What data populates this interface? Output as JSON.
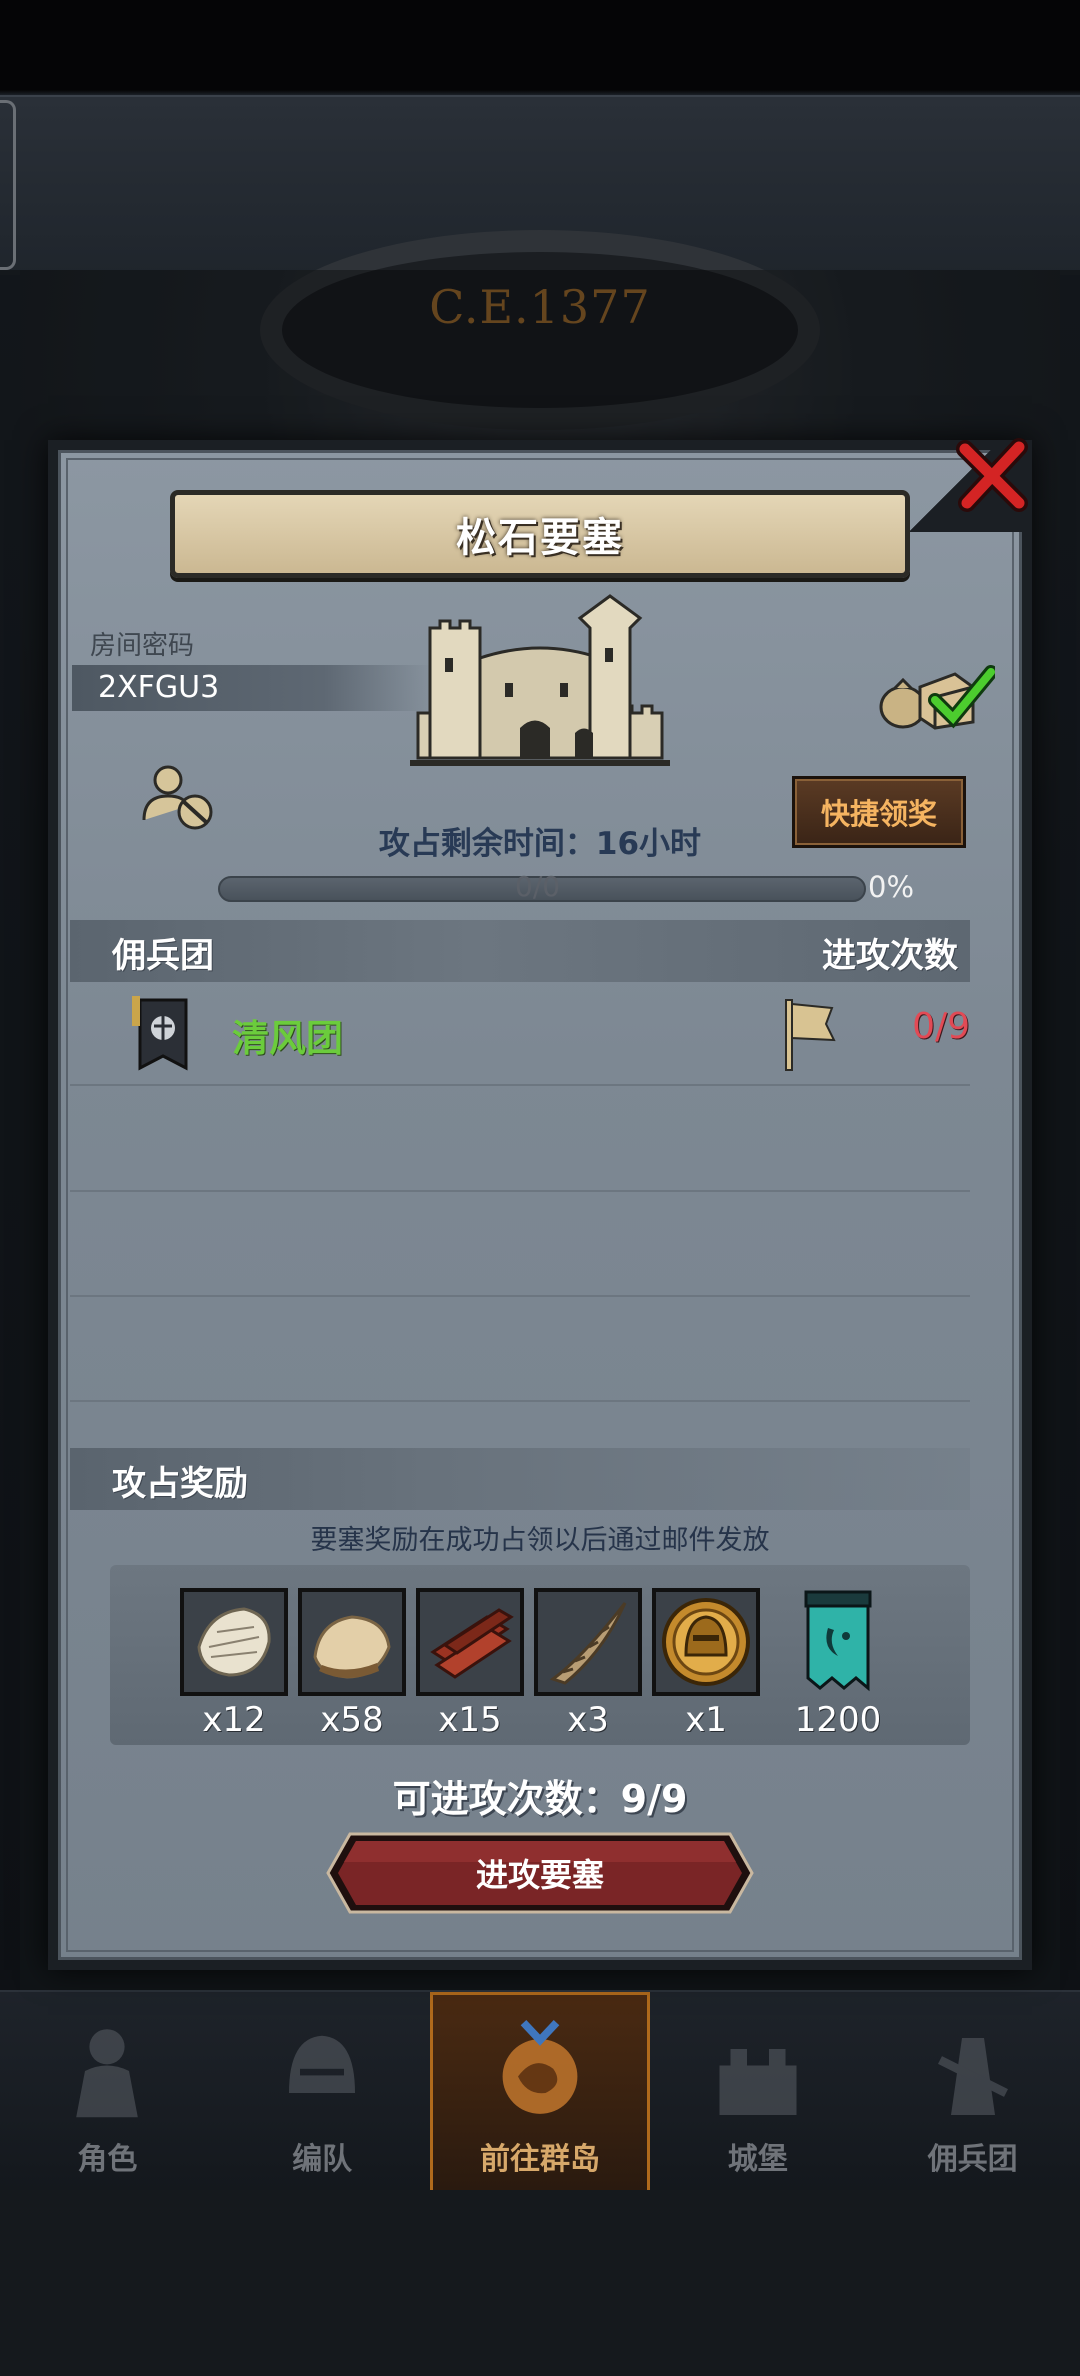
{
  "background": {
    "year": "C.E.1377"
  },
  "bottom_nav": {
    "items": [
      {
        "label": "角色",
        "icon": "knight-icon"
      },
      {
        "label": "编队",
        "icon": "helmet-icon"
      },
      {
        "label": "前往群岛",
        "icon": "island-icon",
        "active": true
      },
      {
        "label": "城堡",
        "icon": "castle-icon"
      },
      {
        "label": "佣兵团",
        "icon": "mercenary-icon"
      }
    ]
  },
  "modal": {
    "title": "松石要塞",
    "room_label": "房间密码",
    "room_code": "2XFGU3",
    "quick_claim_label": "快捷领奖",
    "time_label": "攻占剩余时间：",
    "time_value": "16小时",
    "progress": {
      "text": "0/0",
      "percent": "0%"
    },
    "mercenary_header": "佣兵团",
    "attack_count_header": "进攻次数",
    "mercenaries": [
      {
        "name": "清风团",
        "attacks": "0/9"
      }
    ],
    "rewards_header": "攻占奖励",
    "rewards_note": "要塞奖励在成功占领以后通过邮件发放",
    "rewards": [
      {
        "icon": "feather-pelt-icon",
        "qty": "x12"
      },
      {
        "icon": "wool-pelt-icon",
        "qty": "x58"
      },
      {
        "icon": "wood-planks-icon",
        "qty": "x15"
      },
      {
        "icon": "horn-icon",
        "qty": "x3"
      },
      {
        "icon": "gold-helmet-coin-icon",
        "qty": "x1"
      },
      {
        "icon": "guild-banner-icon",
        "qty": "1200"
      }
    ],
    "remaining_attacks_label": "可进攻次数：",
    "remaining_attacks_value": "9/9",
    "attack_button_label": "进攻要塞"
  }
}
